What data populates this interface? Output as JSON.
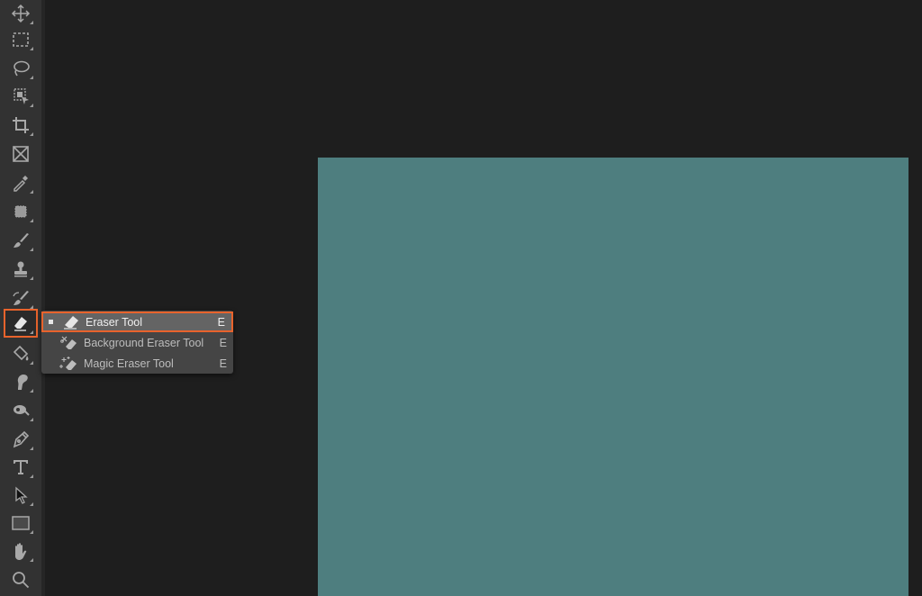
{
  "toolbar": {
    "tools": [
      {
        "name": "Move Tool",
        "icon": "move-icon"
      },
      {
        "name": "Rectangular Marquee Tool",
        "icon": "marquee-icon"
      },
      {
        "name": "Lasso Tool",
        "icon": "lasso-icon"
      },
      {
        "name": "Object Selection Tool",
        "icon": "object-selection-icon"
      },
      {
        "name": "Crop Tool",
        "icon": "crop-icon"
      },
      {
        "name": "Frame Tool",
        "icon": "frame-icon"
      },
      {
        "name": "Eyedropper Tool",
        "icon": "eyedropper-icon"
      },
      {
        "name": "Spot Healing Brush Tool",
        "icon": "healing-icon"
      },
      {
        "name": "Brush Tool",
        "icon": "brush-icon"
      },
      {
        "name": "Clone Stamp Tool",
        "icon": "stamp-icon"
      },
      {
        "name": "History Brush Tool",
        "icon": "history-brush-icon"
      },
      {
        "name": "Eraser Tool",
        "icon": "eraser-icon",
        "active": true
      },
      {
        "name": "Paint Bucket Tool",
        "icon": "paint-bucket-icon"
      },
      {
        "name": "Smudge Tool",
        "icon": "smudge-icon"
      },
      {
        "name": "Dodge Tool",
        "icon": "dodge-icon"
      },
      {
        "name": "Pen Tool",
        "icon": "pen-icon"
      },
      {
        "name": "Type Tool",
        "icon": "type-icon"
      },
      {
        "name": "Path Selection Tool",
        "icon": "path-selection-icon"
      },
      {
        "name": "Rectangle Tool",
        "icon": "rectangle-icon"
      },
      {
        "name": "Hand Tool",
        "icon": "hand-icon"
      },
      {
        "name": "Zoom Tool",
        "icon": "zoom-icon"
      }
    ]
  },
  "flyout": {
    "items": [
      {
        "label": "Eraser Tool",
        "shortcut": "E",
        "selected": true,
        "icon": "eraser-icon"
      },
      {
        "label": "Background Eraser Tool",
        "shortcut": "E",
        "selected": false,
        "icon": "background-eraser-icon"
      },
      {
        "label": "Magic Eraser Tool",
        "shortcut": "E",
        "selected": false,
        "icon": "magic-eraser-icon"
      }
    ]
  },
  "colors": {
    "accent": "#e8632c",
    "canvas_fill": "#4e7e7f",
    "workspace": "#1e1e1e",
    "toolbar": "#323232"
  }
}
